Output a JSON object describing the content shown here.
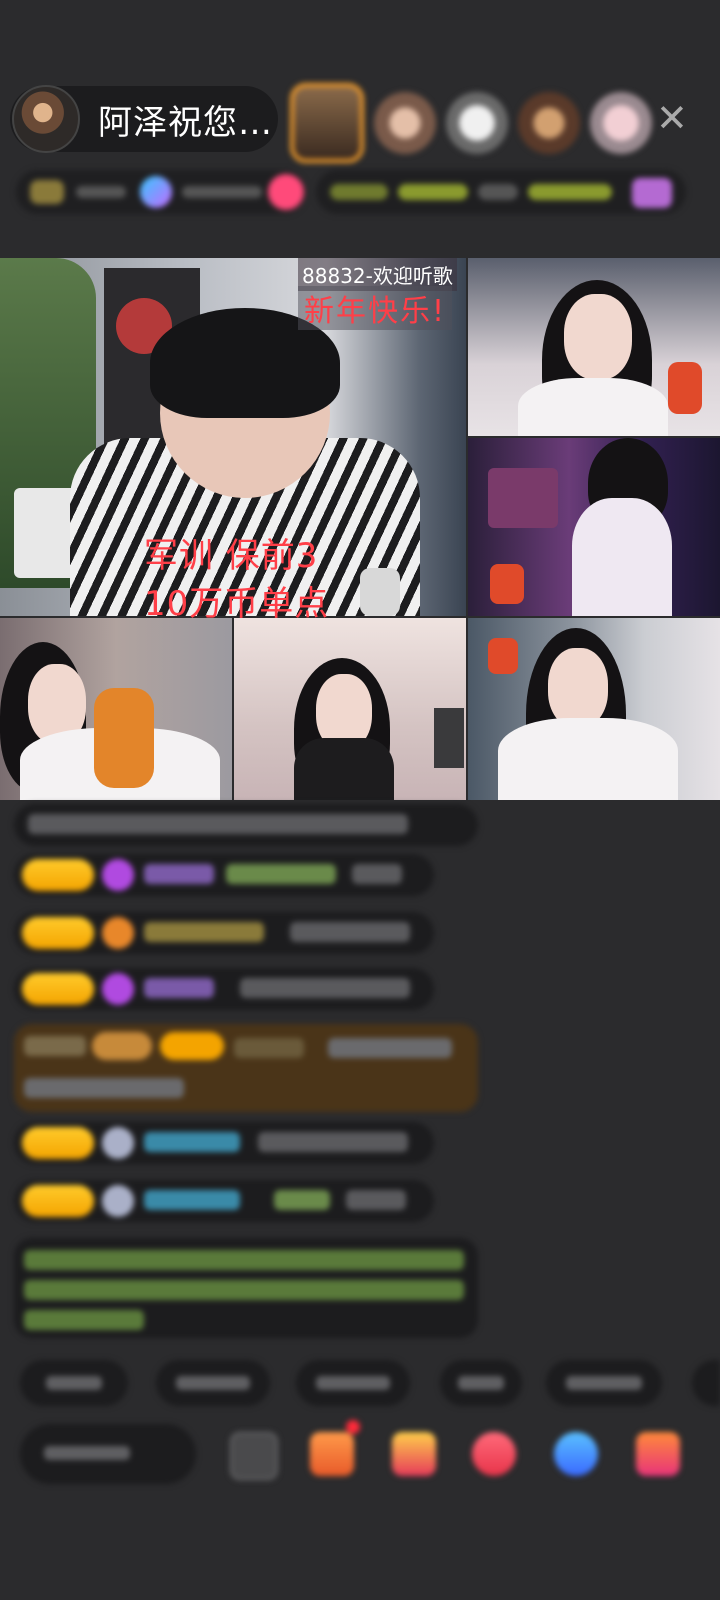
{
  "header": {
    "host_name": "阿泽祝您…"
  },
  "stream": {
    "overlay_top": "88832-欢迎听歌",
    "overlay_new_year": "新年快乐!",
    "overlay_line1": "军训 保前3",
    "overlay_line2": "10万币单点"
  },
  "icons": {
    "close": "close-icon",
    "avatar": "avatar"
  },
  "colors": {
    "background": "#2b2b2d",
    "pill": "#1c1c1e",
    "accent_red": "#ff3f48",
    "badge_yellow": "#ffcb2b"
  }
}
